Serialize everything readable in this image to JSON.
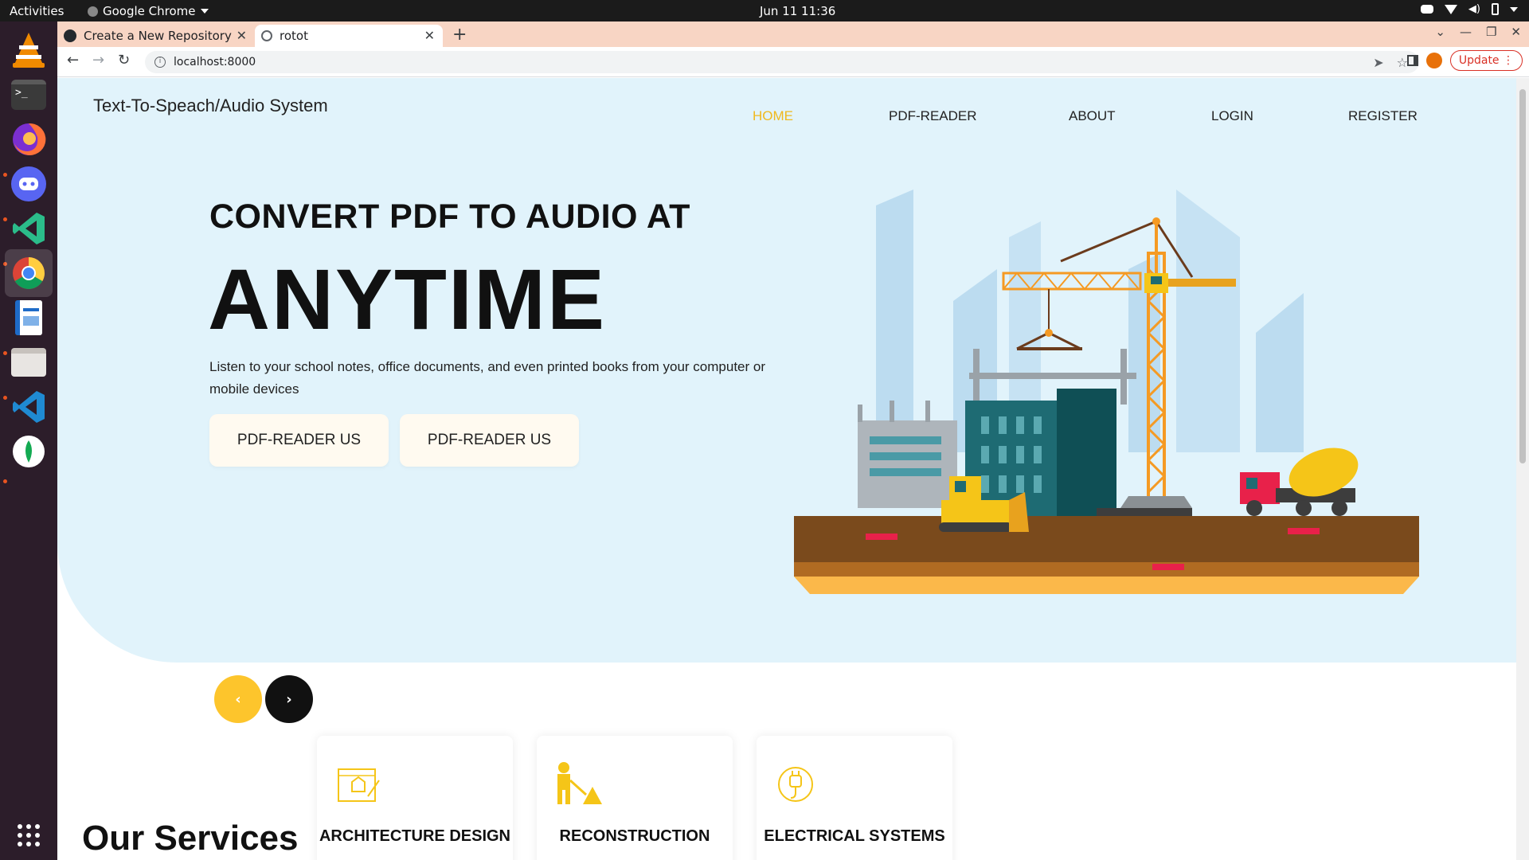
{
  "os": {
    "activities": "Activities",
    "app_name": "Google Chrome",
    "clock": "Jun 11  11:36"
  },
  "browser": {
    "tabs": [
      {
        "title": "Create a New Repository"
      },
      {
        "title": "rotot"
      }
    ],
    "url": "localhost:8000",
    "update_label": "Update"
  },
  "site": {
    "brand": "Text-To-Speach/Audio System",
    "nav": [
      "HOME",
      "PDF-READER",
      "ABOUT",
      "LOGIN",
      "REGISTER"
    ],
    "active_nav": "HOME",
    "accent_color": "#f0b91e",
    "hero": {
      "subtitle": "CONVERT PDF TO AUDIO AT",
      "title": "ANYTIME",
      "description": "Listen to your school notes, office documents, and even printed books from your computer or mobile devices",
      "buttons": [
        "PDF-READER US",
        "PDF-READER US"
      ]
    },
    "carousel": {
      "prev": "‹",
      "next": "›"
    },
    "services": {
      "heading": "Our Services",
      "cards": [
        {
          "title": "ARCHITECTURE DESIGN",
          "icon": "blueprint-icon"
        },
        {
          "title": "RECONSTRUCTION",
          "icon": "worker-icon"
        },
        {
          "title": "ELECTRICAL SYSTEMS",
          "icon": "plug-icon"
        }
      ]
    }
  }
}
